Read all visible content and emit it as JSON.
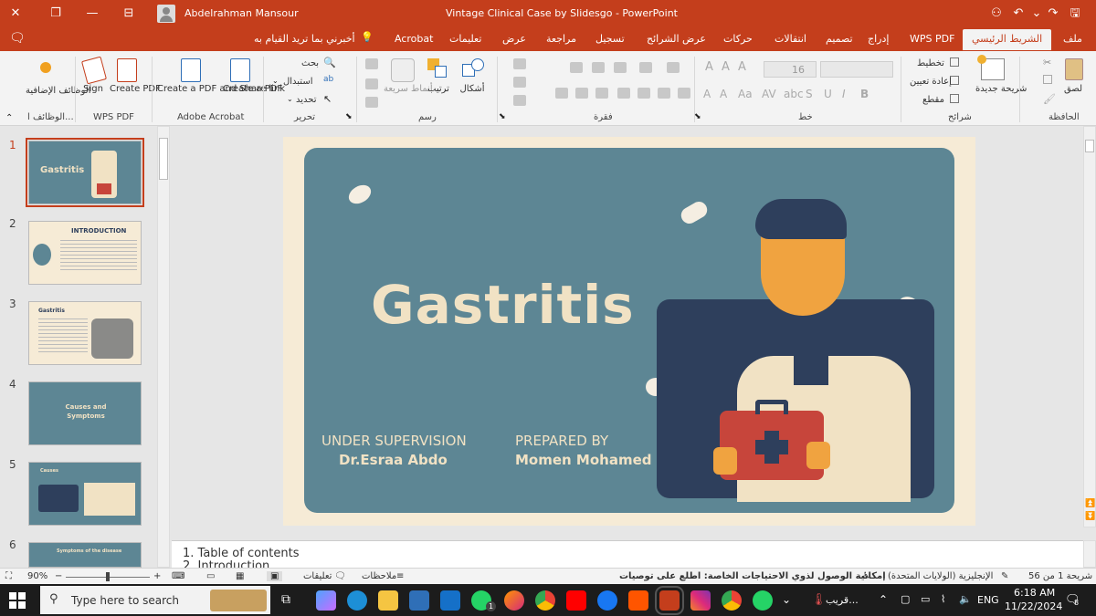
{
  "titlebar": {
    "user_name": "Abdelrahman Mansour",
    "doc_title": "Vintage Clinical Case by Slidesgo  -  PowerPoint"
  },
  "tabs": [
    {
      "label": "ملف"
    },
    {
      "label": "الشريط الرئيسي"
    },
    {
      "label": "WPS PDF"
    },
    {
      "label": "إدراج"
    },
    {
      "label": "تصميم"
    },
    {
      "label": "انتقالات"
    },
    {
      "label": "حركات"
    },
    {
      "label": "عرض الشرائح"
    },
    {
      "label": "تسجيل"
    },
    {
      "label": "مراجعة"
    },
    {
      "label": "عرض"
    },
    {
      "label": "تعليمات"
    },
    {
      "label": "Acrobat"
    },
    {
      "label": "أخبرني بما تريد القيام به"
    }
  ],
  "ribbon": {
    "addins_label": "الوظائف الإضافية",
    "addins_group": "الوظائف ا...",
    "sign": "Sign",
    "create_pdf": "Create PDF",
    "wps_group": "WPS PDF",
    "create_share": "Create a PDF and Share link",
    "create_a_pdf": "Create a PDF",
    "acrobat_group": "Adobe Acrobat",
    "find": "بحث",
    "replace": "استبدال",
    "select": "تحديد",
    "edit_group": "تحرير",
    "styles": "أنماط سريعة",
    "arrange": "ترتيب",
    "shapes": "أشكال",
    "drawing_group": "رسم",
    "paragraph_group": "فقرة",
    "font_size": "16",
    "font_group": "خط",
    "layout": "تخطيط",
    "reset": "إعادة تعيين",
    "section": "مقطع",
    "new_slide": "شريحة جديدة",
    "slides_group": "شرائح",
    "paste": "لصق",
    "clipboard_group": "الحافظة"
  },
  "thumbnails": {
    "nums": [
      "1",
      "2",
      "3",
      "4",
      "5",
      "6"
    ],
    "t1_title": "Gastritis",
    "t2_title": "INTRODUCTION",
    "t3_title": "Gastritis",
    "t4_title": "Causes and Symptoms",
    "t5_title": "Causes",
    "t6_title": "Symptoms of the disease"
  },
  "slide": {
    "title": "Gastritis",
    "supervision_label": "UNDER SUPERVISION",
    "supervisor": "Dr.Esraa Abdo",
    "prepared_label": "PREPARED BY",
    "preparer": "Momen Mohamed"
  },
  "notes": {
    "line1": "1. Table of contents",
    "line2": "2. Introduction"
  },
  "statusbar": {
    "zoom": "90%",
    "comments": "تعليقات",
    "notes": "ملاحظات",
    "accessibility": "إمكانية الوصول لذوي الاحتياجات الخاصة: اطلع على توصيات",
    "language": "الإنجليزية (الولايات المتحدة)",
    "slide_count": "شريحة 1 من 56"
  },
  "taskbar": {
    "search_placeholder": "Type here to search",
    "weather": "قريب...",
    "lang": "ENG",
    "time": "6:18 AM",
    "date": "11/22/2024",
    "notif_count": "8",
    "whatsapp_badge": "1"
  },
  "colors": {
    "accent": "#c43e1c",
    "slide_bg": "#5d8694",
    "slide_cream": "#f1e2c4",
    "slide_frame": "#f6ebd6",
    "navy": "#2e3f5c",
    "kit_red": "#c7453b"
  }
}
